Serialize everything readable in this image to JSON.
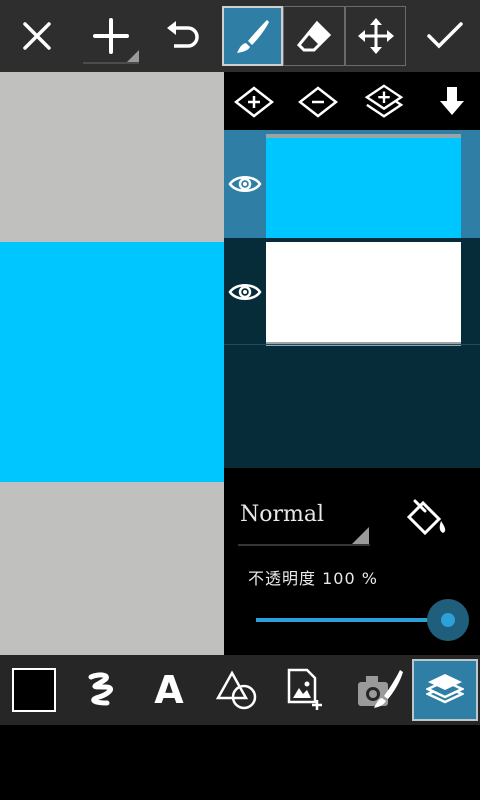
{
  "top_toolbar": {
    "tools": [
      {
        "name": "close-icon"
      },
      {
        "name": "add-icon"
      },
      {
        "name": "undo-icon"
      },
      {
        "name": "brush-icon",
        "active": true
      },
      {
        "name": "eraser-icon"
      },
      {
        "name": "move-icon"
      },
      {
        "name": "checkmark-icon"
      }
    ]
  },
  "canvas": {
    "background_color": "#c0c1bf",
    "fill_color": "#00c6ff"
  },
  "layer_actions": [
    {
      "name": "add-layer-icon"
    },
    {
      "name": "remove-layer-icon"
    },
    {
      "name": "duplicate-layer-icon"
    },
    {
      "name": "merge-down-icon"
    }
  ],
  "layers": [
    {
      "thumbnail_color": "#00c6ff",
      "selected": true,
      "visible": true
    },
    {
      "thumbnail_color": "#ffffff",
      "selected": false,
      "visible": true
    }
  ],
  "blend": {
    "mode": "Normal",
    "opacity_label": "不透明度 100 %",
    "opacity_value": 1.0
  },
  "bottom_toolbar": {
    "tools": [
      {
        "name": "color-swatch",
        "color": "#000000"
      },
      {
        "name": "stroke-icon"
      },
      {
        "name": "text-icon",
        "label": "A"
      },
      {
        "name": "shapes-icon"
      },
      {
        "name": "add-image-icon"
      },
      {
        "name": "camera-brush-icon"
      },
      {
        "name": "layers-icon",
        "active": true
      }
    ]
  },
  "colors": {
    "accent": "#2ea0d8",
    "selected_layer": "#2f7ea6",
    "layer_list_bg": "#052c38"
  }
}
